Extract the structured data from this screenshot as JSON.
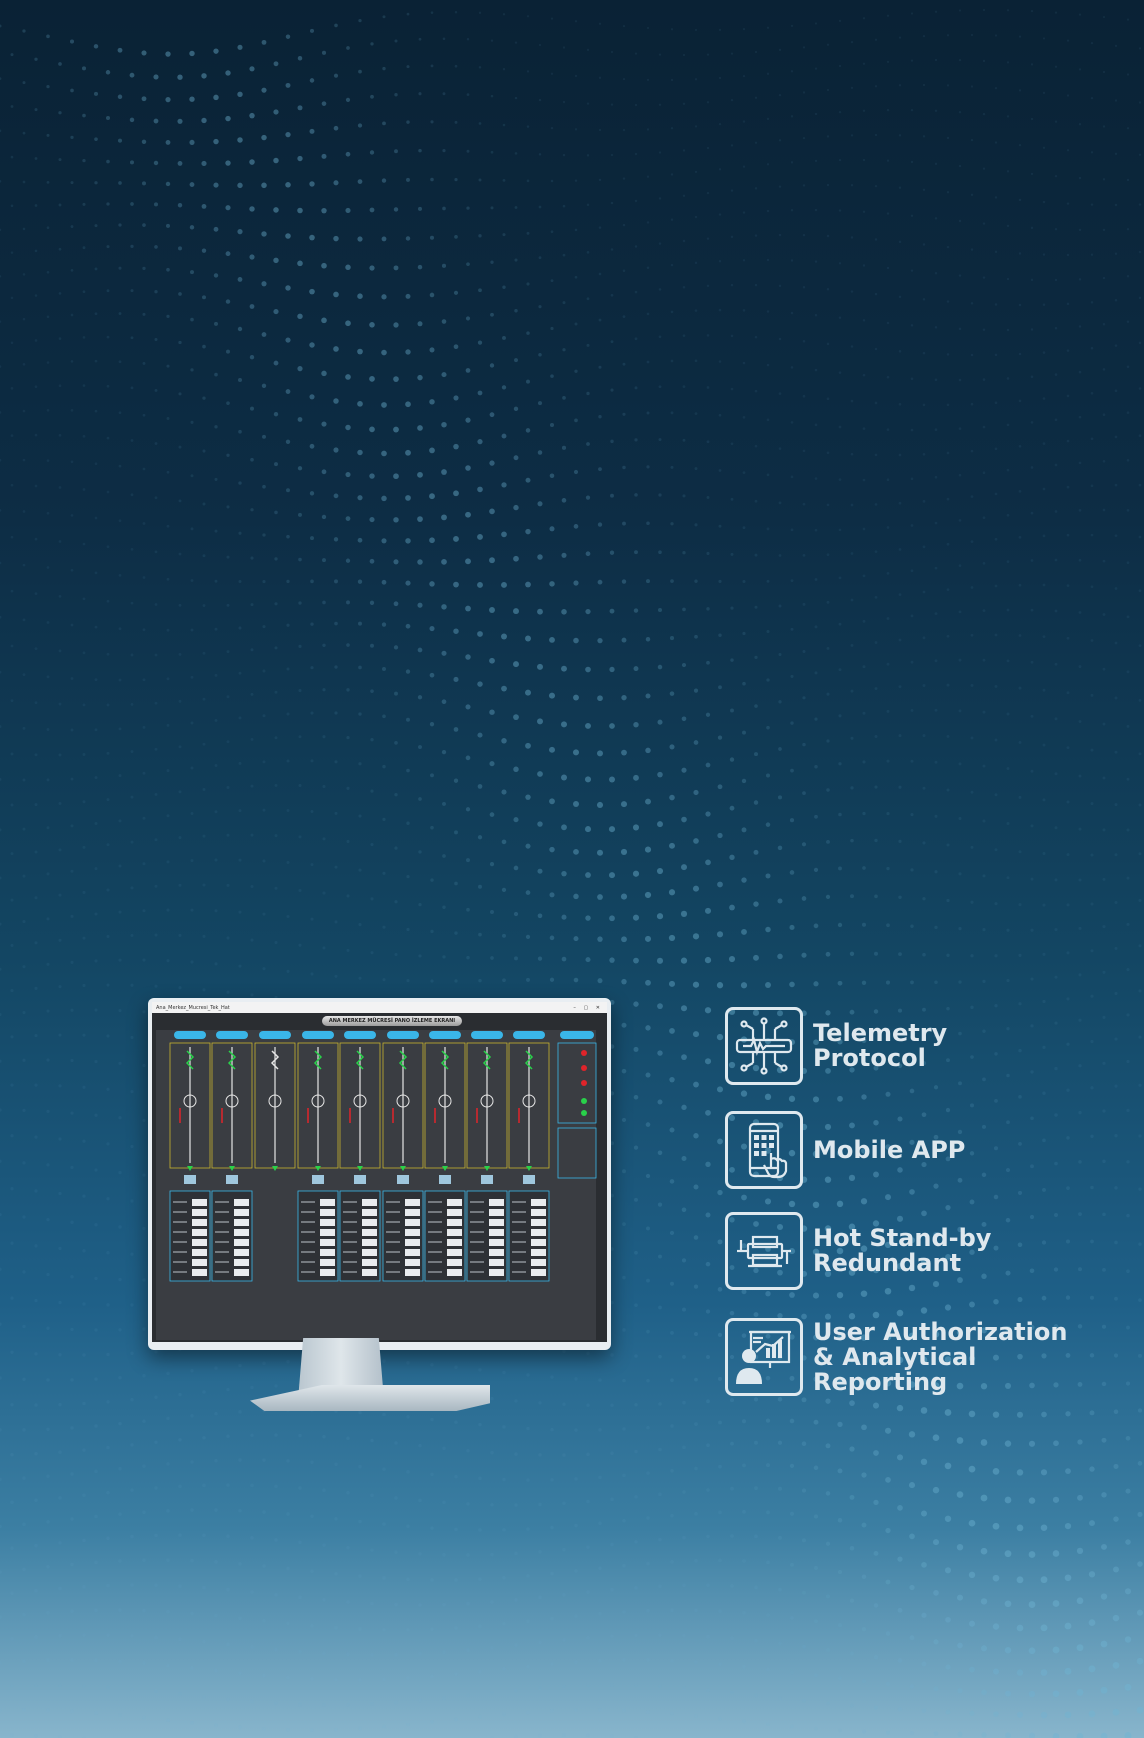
{
  "monitor": {
    "window_title": "Ana_Merkez_Mucresi_Tek_Hat",
    "app_title": "ANA MERKEZ MÜCRESİ PANO İZLEME EKRANI"
  },
  "features": [
    {
      "label": "Telemetry\nProtocol",
      "icon": "telemetry-circuit-icon"
    },
    {
      "label": "Mobile APP",
      "icon": "mobile-touch-icon"
    },
    {
      "label": "Hot Stand-by\nRedundant",
      "icon": "redundant-connector-icon"
    },
    {
      "label": "User Authorization\n& Analytical\nReporting",
      "icon": "user-presentation-icon"
    }
  ],
  "colors": {
    "background_top": "#0a2235",
    "background_bottom": "#88b5cc",
    "feature_text": "#dfe8ee",
    "scada_green": "#29d14a",
    "scada_red": "#e0242a",
    "scada_cyan": "#3ab6e8"
  }
}
